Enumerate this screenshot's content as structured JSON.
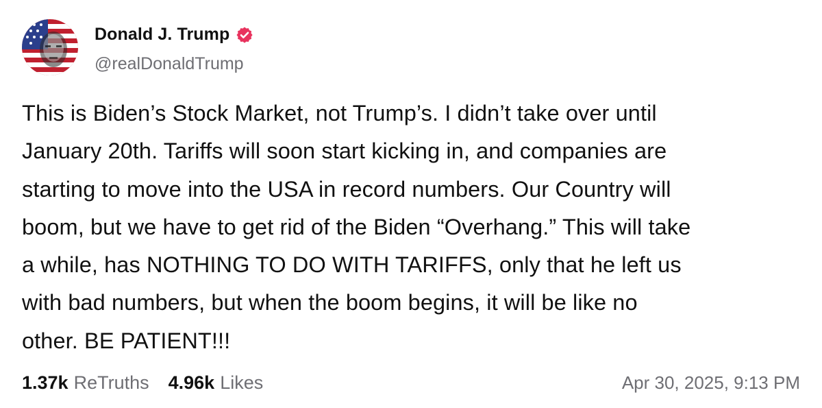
{
  "author": {
    "display_name": "Donald J. Trump",
    "handle": "@realDonaldTrump",
    "verified": true,
    "avatar_icon": "avatar-flag-portrait",
    "verified_icon": "verified-badge-icon"
  },
  "post": {
    "lines": [
      "This is Biden’s Stock Market, not Trump’s. I didn’t take over until",
      "January 20th. Tariffs will soon start kicking in, and companies are",
      "starting to move into the USA in record numbers. Our Country will",
      "boom, but we have to get rid of the Biden “Overhang.” This will take",
      "a while, has NOTHING TO DO WITH TARIFFS, only that he left us",
      "with bad numbers, but when the boom begins, it will be like no",
      "other. BE PATIENT!!!"
    ]
  },
  "stats": {
    "retruths_count": "1.37k",
    "retruths_label": "ReTruths",
    "likes_count": "4.96k",
    "likes_label": "Likes"
  },
  "timestamp": "Apr 30, 2025, 9:13 PM",
  "colors": {
    "text_primary": "#111111",
    "text_secondary": "#6e6e73",
    "verified_badge": "#e8335e",
    "background": "#ffffff"
  }
}
